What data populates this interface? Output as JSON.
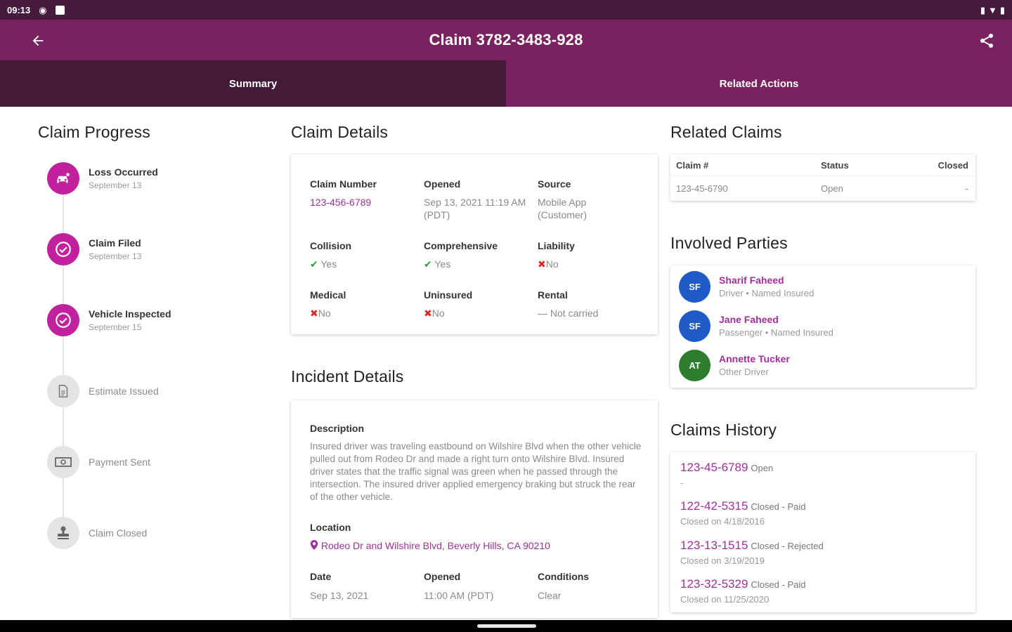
{
  "status_bar": {
    "time": "09:13"
  },
  "app_bar": {
    "title": "Claim 3782-3483-928",
    "back_icon": "arrow-left-icon",
    "share_icon": "share-icon"
  },
  "tabs": [
    {
      "label": "Summary",
      "active": true
    },
    {
      "label": "Related Actions",
      "active": false
    }
  ],
  "claim_progress": {
    "heading": "Claim Progress",
    "steps": [
      {
        "label": "Loss Occurred",
        "date": "September 13",
        "done": true,
        "icon": "car-crash-icon"
      },
      {
        "label": "Claim Filed",
        "date": "September 13",
        "done": true,
        "icon": "check-circle-icon"
      },
      {
        "label": "Vehicle Inspected",
        "date": "September 15",
        "done": true,
        "icon": "check-circle-icon"
      },
      {
        "label": "Estimate Issued",
        "date": "",
        "done": false,
        "icon": "document-icon"
      },
      {
        "label": "Payment Sent",
        "date": "",
        "done": false,
        "icon": "cash-icon"
      },
      {
        "label": "Claim Closed",
        "date": "",
        "done": false,
        "icon": "stamp-icon"
      }
    ]
  },
  "claim_details": {
    "heading": "Claim Details",
    "claim_number": {
      "label": "Claim Number",
      "value": "123-456-6789"
    },
    "opened": {
      "label": "Opened",
      "value": "Sep 13, 2021 11:19 AM (PDT)"
    },
    "source": {
      "label": "Source",
      "value": "Mobile App (Customer)"
    },
    "collision": {
      "label": "Collision",
      "value": "Yes"
    },
    "comprehensive": {
      "label": "Comprehensive",
      "value": "Yes"
    },
    "liability": {
      "label": "Liability",
      "value": "No"
    },
    "medical": {
      "label": "Medical",
      "value": "No"
    },
    "uninsured": {
      "label": "Uninsured",
      "value": "No"
    },
    "rental": {
      "label": "Rental",
      "value": "Not carried"
    }
  },
  "incident_details": {
    "heading": "Incident Details",
    "description_label": "Description",
    "description": "Insured driver was traveling eastbound on Wilshire Blvd when the other vehicle pulled out from Rodeo Dr and made a right turn onto Wilshire Blvd. Insured driver states that the traffic signal was green when he passed through the intersection. The insured driver applied emergency braking but struck the rear of the other vehicle.",
    "location_label": "Location",
    "location": "Rodeo Dr and Wilshire Blvd, Beverly Hills, CA 90210",
    "date_label": "Date",
    "date": "Sep 13, 2021",
    "opened_label": "Opened",
    "opened": "11:00 AM (PDT)",
    "conditions_label": "Conditions",
    "conditions": "Clear"
  },
  "related_claims": {
    "heading": "Related Claims",
    "columns": [
      "Claim #",
      "Status",
      "Closed"
    ],
    "rows": [
      {
        "claim": "123-45-6790",
        "status": "Open",
        "closed": "-"
      }
    ]
  },
  "involved_parties": {
    "heading": "Involved Parties",
    "parties": [
      {
        "initials": "SF",
        "name": "Sharif Faheed",
        "role": "Driver • Named Insured",
        "color": "#1f5bc6"
      },
      {
        "initials": "SF",
        "name": "Jane Faheed",
        "role": "Passenger • Named Insured",
        "color": "#1f5bc6"
      },
      {
        "initials": "AT",
        "name": "Annette Tucker",
        "role": "Other Driver",
        "color": "#2e7d2e"
      }
    ]
  },
  "claims_history": {
    "heading": "Claims History",
    "items": [
      {
        "number": "123-45-6789",
        "status": "Open",
        "sub": "-"
      },
      {
        "number": "122-42-5315",
        "status": "Closed - Paid",
        "sub": "Closed on 4/18/2016"
      },
      {
        "number": "123-13-1515",
        "status": "Closed - Rejected",
        "sub": "Closed on 3/19/2019"
      },
      {
        "number": "123-32-5329",
        "status": "Closed - Paid",
        "sub": "Closed on 11/25/2020"
      }
    ]
  },
  "colors": {
    "accent": "#7a2260",
    "tab_active": "#431b39",
    "link": "#a0309a",
    "step_done": "#c2219e"
  }
}
